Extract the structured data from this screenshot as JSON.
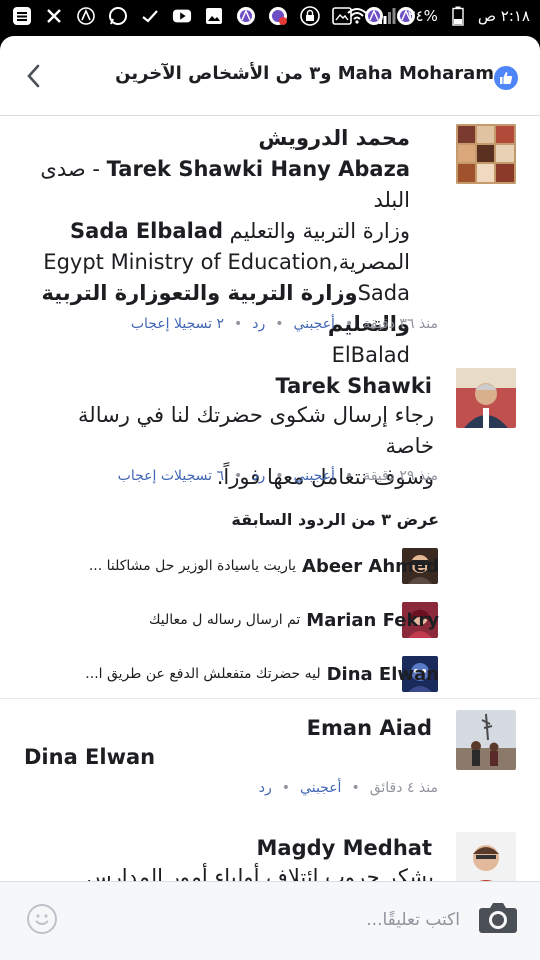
{
  "status_bar": {
    "time": "٢:١٨ ص",
    "battery": "%٢٤",
    "left_icons": [
      "menu-icon",
      "close-x-icon",
      "signal-app-icon",
      "whatsapp-icon",
      "check-icon",
      "youtube-icon",
      "gallery-icon",
      "opera-icon",
      "alert-app-icon",
      "lock-icon",
      "screenshot-icon",
      "opera-icon",
      "opera-icon"
    ],
    "right_icons": [
      "wifi-icon",
      "signal-bars-icon",
      "battery-icon"
    ]
  },
  "header": {
    "title": "Maha Moharam و٣ من الأشخاص الآخرين",
    "like_color": "#4e86f7"
  },
  "comments": [
    {
      "author": "محمد الدرويش",
      "lines": [
        {
          "bold": "Tarek Shawki Hany Abaza",
          "normal_after": " - صدى البلد",
          "bold_first": "Tarek Shawki Hany Abaza"
        },
        {
          "text": "وزارة التربية والتعليم Sada Elbalad"
        },
        {
          "text": "المصرية,Egypt Ministry of Education"
        },
        {
          "text": "Sadaوزارة التربية والتعوزارة التربية والتعليم"
        },
        {
          "text": "ElBalad"
        }
      ],
      "meta": {
        "time": "منذ ٣٦ دقيقة",
        "like": "أعجبني",
        "reply": "رد",
        "count": "٢ تسجيلا إعجاب"
      }
    },
    {
      "author": "Tarek Shawki",
      "lines": [
        {
          "text": "رجاء إرسال شكوى حضرتك لنا في رسالة خاصة"
        },
        {
          "text": "وسوف نتعامل معها فوراً."
        }
      ],
      "meta": {
        "time": "منذ ٢٩ دقيقة",
        "like": "أعجبني",
        "reply": "رد",
        "count": "٦ تسجيلات إعجاب"
      }
    },
    {
      "author": "Eman Aiad",
      "lines": [
        {
          "text": "Dina Elwan"
        }
      ],
      "meta": {
        "time": "منذ ٤ دقائق",
        "like": "أعجبني",
        "reply": "رد"
      }
    },
    {
      "author": "Magdy Medhat",
      "lines": [
        {
          "text": "بشكر جروب ائتلاف أولياء أمور المدارس"
        }
      ]
    }
  ],
  "previous_replies": {
    "label": "عرض ٣ من الردود السابقة",
    "items": [
      {
        "name": "Abeer Ahmed",
        "text": "ياريت ياسيادة الوزير حل مشاكلنا ..."
      },
      {
        "name": "Marian Fekry",
        "text": "تم ارسال رساله ل معاليك"
      },
      {
        "name": "Dina Elwan",
        "text": "ليه حضرتك متفعلش الدفع عن طريق ا..."
      }
    ]
  },
  "composer": {
    "placeholder": "اكتب تعليقًا..."
  }
}
